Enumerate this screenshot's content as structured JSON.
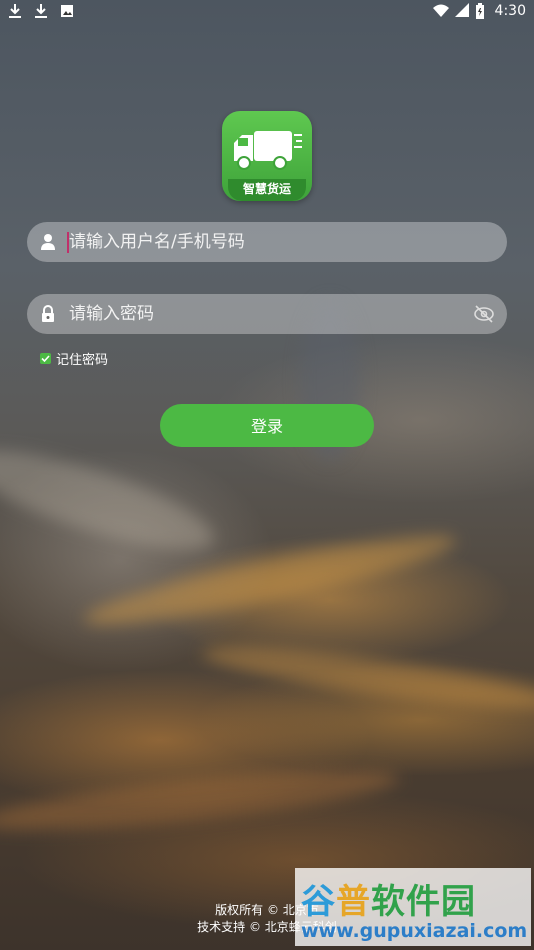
{
  "status_bar": {
    "left_icons": [
      "download-icon",
      "download-icon",
      "photo-icon"
    ],
    "right_icons": [
      "wifi-icon",
      "signal-icon",
      "battery-icon"
    ],
    "time": "4:30"
  },
  "app": {
    "logo_text": "智慧货运"
  },
  "login_form": {
    "username_placeholder": "请输入用户名/手机号码",
    "password_placeholder": "请输入密码",
    "remember_label": "记住密码",
    "remember_checked": true,
    "login_label": "登录"
  },
  "footer": {
    "copyright": "版权所有 © 北京市",
    "support": "技术支持 © 北京蜂云科创"
  },
  "watermark": {
    "title_a": "谷",
    "title_b": "普",
    "title_c": "软件园",
    "url": "www.gupuxiazai.com"
  },
  "colors": {
    "accent": "#4cb944",
    "caret": "#c0306a"
  }
}
